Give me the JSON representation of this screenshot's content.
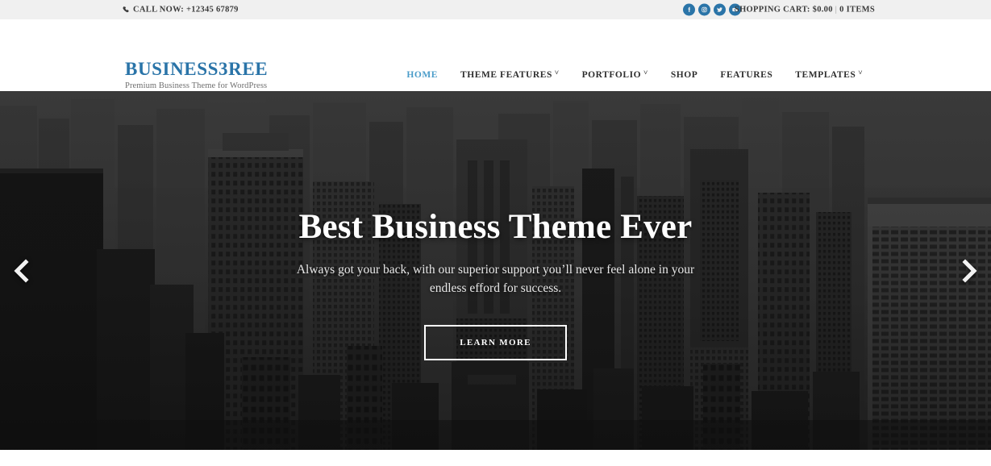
{
  "topbar": {
    "phone_icon": "phone-icon",
    "call_now": "CALL NOW: +12345 67879",
    "social": [
      {
        "name": "facebook-icon",
        "label": "Facebook"
      },
      {
        "name": "instagram-icon",
        "label": "Instagram"
      },
      {
        "name": "twitter-icon",
        "label": "Twitter"
      },
      {
        "name": "youtube-icon",
        "label": "YouTube"
      }
    ],
    "cart_label": "SHOPPING CART: $0.00",
    "cart_sep": "|",
    "cart_items": "0 ITEMS",
    "bg_color": "#f0f0f0"
  },
  "header": {
    "logo": "BUSINESS3REE",
    "tagline": "Premium Business Theme for WordPress",
    "logo_color": "#2a74a8",
    "nav": [
      {
        "label": "HOME",
        "caret": "",
        "active": true
      },
      {
        "label": "THEME FEATURES",
        "caret": "˅",
        "active": false
      },
      {
        "label": "PORTFOLIO",
        "caret": "˅",
        "active": false
      },
      {
        "label": "SHOP",
        "caret": "",
        "active": false
      },
      {
        "label": "FEATURES",
        "caret": "",
        "active": false
      },
      {
        "label": "TEMPLATES",
        "caret": "˅",
        "active": false
      }
    ],
    "active_color": "#4a9cc9"
  },
  "hero": {
    "title": "Best Business Theme Ever",
    "subtitle": "Always got your back, with our superior support you’ll never feel alone in your endless efford for success.",
    "button_label": "LEARN MORE",
    "prev_icon": "chevron-left-icon",
    "next_icon": "chevron-right-icon",
    "background": "grayscale city skyline photograph"
  }
}
